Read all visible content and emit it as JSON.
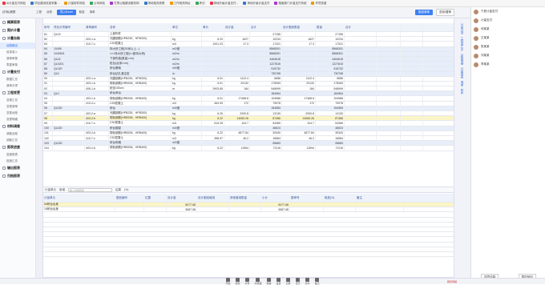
{
  "bookmarks": [
    "Ai计量支付网站",
    "项目建设信息采集...",
    "计量软件网站",
    "公司网站",
    "甘肃公路建设服务网",
    "场地相关政策",
    "工作相关网址",
    "考试",
    "场地升级计量支付...",
    "场地升级计量支付",
    "路面部门计量支付系统",
    "环境查重"
  ],
  "app": {
    "title": "(中标)报表",
    "tabs": [
      "工程",
      "台账",
      "导入Excel",
      "取费",
      "清单",
      "工程量清单表"
    ],
    "import_btn": "导入Excel",
    "active_tab": "取费清单",
    "search_btn": "查找/替换"
  },
  "sidebar": [
    {
      "label": "概算报表",
      "type": "group"
    },
    {
      "label": "报价计量",
      "type": "group"
    },
    {
      "label": "计量台账",
      "type": "group"
    },
    {
      "label": "台账输出",
      "type": "sub",
      "active": true
    },
    {
      "label": "信息录入",
      "type": "sub"
    },
    {
      "label": "清单审核",
      "type": "sub"
    },
    {
      "label": "零星审核",
      "type": "sub"
    },
    {
      "label": "计量支付",
      "type": "group"
    },
    {
      "label": "数据汇总",
      "type": "sub"
    },
    {
      "label": "清单分项",
      "type": "sub"
    },
    {
      "label": "工程变更",
      "type": "group"
    },
    {
      "label": "变更汇总",
      "type": "sub"
    },
    {
      "label": "变更清单",
      "type": "sub"
    },
    {
      "label": "变更台账",
      "type": "sub"
    },
    {
      "label": "变更明细",
      "type": "sub"
    },
    {
      "label": "材料调差",
      "type": "group"
    },
    {
      "label": "调差台账",
      "type": "sub"
    },
    {
      "label": "调差汇总",
      "type": "sub"
    },
    {
      "label": "报表进度",
      "type": "group"
    },
    {
      "label": "进度报表",
      "type": "sub"
    },
    {
      "label": "进度汇总",
      "type": "sub"
    },
    {
      "label": "输出报表",
      "type": "group"
    },
    {
      "label": "归档报表",
      "type": "group"
    }
  ],
  "grid": {
    "headers": [
      "序号",
      "项目分项编号",
      "清单编号",
      "名称",
      "单位",
      "单价",
      "设计量",
      "合计",
      "设计图纸数量",
      "数量",
      "合计",
      "",
      "",
      ""
    ],
    "rows": [
      {
        "n": "81",
        "a": "QL03",
        "b": "",
        "name": "上部构件",
        "unit": "",
        "price": "",
        "q": "",
        "t": "27155",
        "q2": "",
        "t2": "27155",
        "x": "",
        "y": "",
        "z": "",
        "cls": ""
      },
      {
        "n": "82",
        "a": "",
        "b": "403-1-a",
        "name": "光圆钢筋(HPB235、HPB300)",
        "unit": "kg",
        "price": "6.29",
        "q": "1627",
        "t": "10234",
        "q2": "1627",
        "t2": "10234",
        "x": "",
        "y": "",
        "z": "",
        "cls": ""
      },
      {
        "n": "83",
        "a": "",
        "b": "410-7-c",
        "name": "C30混凝土",
        "unit": "m3",
        "price": "1001.23",
        "q": "17.3",
        "t": "17321",
        "q2": "17.3",
        "t2": "17321",
        "x": "",
        "y": "",
        "z": "",
        "cls": ""
      },
      {
        "n": "84",
        "a": "10405",
        "b": "",
        "name": "特大桥工程(30米以上...)",
        "unit": "m2/座",
        "price": "",
        "q": "",
        "t": "8568301",
        "q2": "",
        "t2": "8568301",
        "x": "",
        "y": "",
        "z": "",
        "cls": "blue"
      },
      {
        "n": "85",
        "a": "1040501",
        "b": "",
        "name": "×××特大桥工程(××座特大桥)",
        "unit": "m2/m",
        "price": "",
        "q": "",
        "t": "8568301",
        "q2": "",
        "t2": "8568301",
        "x": "",
        "y": "",
        "z": "",
        "cls": "blue"
      },
      {
        "n": "86",
        "a": "QL02",
        "b": "",
        "name": "下部构造(数量××m)",
        "unit": "m2/m",
        "price": "",
        "q": "",
        "t": "4464618",
        "q2": "",
        "t2": "4464618",
        "x": "",
        "y": "",
        "z": "",
        "cls": "blue"
      },
      {
        "n": "87",
        "a": "QL0201",
        "b": "",
        "name": "桩台(台身××m)",
        "unit": "m2/m",
        "price": "",
        "q": "",
        "t": "1227815",
        "q2": "",
        "t2": "1227815",
        "x": "",
        "y": "",
        "z": "",
        "cls": "blue"
      },
      {
        "n": "88",
        "a": "QL020",
        "b": "",
        "name": "桥台基础",
        "unit": "m3/座",
        "price": "",
        "q": "",
        "t": "915732",
        "q2": "",
        "t2": "915732",
        "x": "",
        "y": "",
        "z": "",
        "cls": "blue"
      },
      {
        "n": "89",
        "a": "QL0",
        "b": "",
        "name": "桥台钻孔灌注桩",
        "unit": "m",
        "price": "",
        "q": "",
        "t": "730768",
        "q2": "",
        "t2": "730768",
        "x": "",
        "y": "",
        "z": "",
        "cls": "blue"
      },
      {
        "n": "90",
        "a": "",
        "b": "403-1-a",
        "name": "光圆钢筋(HPB235、HPB300)",
        "unit": "kg",
        "price": "6.01",
        "q": "1112.4",
        "t": "6686",
        "q2": "1112.4",
        "t2": "6686",
        "x": "",
        "y": "",
        "z": "",
        "cls": ""
      },
      {
        "n": "91",
        "a": "",
        "b": "403-1-b",
        "name": "带肋钢筋(HRB335、HRB400)",
        "unit": "kg",
        "price": "6.01",
        "q": "29132",
        "t": "175083",
        "q2": "29132",
        "t2": "175083",
        "x": "",
        "y": "",
        "z": "",
        "cls": ""
      },
      {
        "n": "92",
        "a": "",
        "b": "405-1-b",
        "name": "桩径150cm",
        "unit": "m",
        "price": "2903.65",
        "q": "184",
        "t": "548999",
        "q2": "184",
        "t2": "548999",
        "x": "",
        "y": "",
        "z": "",
        "cls": ""
      },
      {
        "n": "93",
        "a": "QLC",
        "b": "",
        "name": "桥台承台",
        "unit": "",
        "price": "",
        "q": "",
        "t": "184964",
        "q2": "",
        "t2": "184964",
        "x": "",
        "y": "",
        "z": "",
        "cls": "blue"
      },
      {
        "n": "94",
        "a": "",
        "b": "403-1-b",
        "name": "带肋钢筋(HRB335、HRB400)",
        "unit": "kg",
        "price": "6.01",
        "q": "17468.6",
        "t": "104986",
        "q2": "17468.6",
        "t2": "104986",
        "x": "",
        "y": "",
        "z": "",
        "cls": ""
      },
      {
        "n": "95",
        "a": "",
        "b": "410-2-c",
        "name": "C25混凝土",
        "unit": "m3",
        "price": "464.99",
        "q": "172",
        "t": "79978",
        "q2": "172",
        "t2": "79978",
        "x": "",
        "y": "",
        "z": "",
        "cls": ""
      },
      {
        "n": "96",
        "a": "QL020",
        "b": "",
        "name": "桥台",
        "unit": "m3/座",
        "price": "",
        "q": "",
        "t": "154983",
        "q2": "",
        "t2": "154983",
        "x": "",
        "y": "",
        "z": "",
        "cls": "blue"
      },
      {
        "n": "97",
        "a": "",
        "b": "403-2-a",
        "name": "光圆钢筋(HPB235、HPB300)",
        "unit": "kg",
        "price": "6.26",
        "q": "2090.8",
        "t": "13130",
        "q2": "2090.8",
        "t2": "13130",
        "x": "",
        "y": "",
        "z": "",
        "cls": ""
      },
      {
        "n": "98",
        "a": "",
        "b": "403-2-b",
        "name": "带肋钢筋(HRB335、HRB400)",
        "unit": "kg",
        "price": "6.22",
        "q": "14065.26",
        "t": "87486",
        "q2": "14065.26",
        "t2": "87486",
        "x": "",
        "y": "",
        "z": "",
        "cls": "sel"
      },
      {
        "n": "99",
        "a": "",
        "b": "410-7-c",
        "name": "C30混凝土",
        "unit": "m3",
        "price": "519.25",
        "q": "104.7",
        "t": "54365",
        "q2": "104.7",
        "t2": "54365",
        "x": "",
        "y": "",
        "z": "",
        "cls": ""
      },
      {
        "n": "100",
        "a": "QL020",
        "b": "",
        "name": "桥台帽梁",
        "unit": "m3/座",
        "price": "",
        "q": "",
        "t": "46524",
        "q2": "",
        "t2": "46524",
        "x": "",
        "y": "",
        "z": "",
        "cls": "blue"
      },
      {
        "n": "101",
        "a": "",
        "b": "403-2-b",
        "name": "带肋钢筋(HRB335、HRB400)",
        "unit": "kg",
        "price": "6.22",
        "q": "4877.84",
        "t": "30340",
        "q2": "4877.84",
        "t2": "30340",
        "x": "",
        "y": "",
        "z": "",
        "cls": ""
      },
      {
        "n": "102",
        "a": "",
        "b": "410-7-c",
        "name": "C30混凝土",
        "unit": "m3",
        "price": "358.97",
        "q": "46.2",
        "t": "16584",
        "q2": "46.2",
        "t2": "16584",
        "x": "",
        "y": "",
        "z": "",
        "cls": ""
      },
      {
        "n": "103",
        "a": "QL020",
        "b": "",
        "name": "桥台侧墙",
        "unit": "m3/座",
        "price": "",
        "q": "",
        "t": "95683",
        "q2": "",
        "t2": "95683",
        "x": "",
        "y": "",
        "z": "",
        "cls": "blue"
      },
      {
        "n": "104",
        "a": "",
        "b": "403-2-b",
        "name": "带肋钢筋(HRB335、HRB400)",
        "unit": "kg",
        "price": "6.22",
        "q": "11594",
        "t": "72115",
        "q2": "11594",
        "t2": "72115",
        "x": "",
        "y": "",
        "z": "",
        "cls": ""
      }
    ]
  },
  "toolbar2": {
    "label": "计量单元",
    "add": "新增",
    "input_placeholder": "输入内容查找",
    "result": "结果",
    "pct": "(%)"
  },
  "grid2": {
    "headers": [
      "计量单元",
      "图纸编号",
      "位置",
      "设计量",
      "设计图纸增减",
      "其他增减数量",
      "小计",
      "图审号",
      "取费(%)",
      "备注"
    ],
    "rows": [
      {
        "n": "1",
        "name": "0#桥台台身",
        "q": "8477.68",
        "sum": "8477.68"
      },
      {
        "n": "2",
        "name": "1#桥台台身",
        "q": "5587.58",
        "sum": "5587.58"
      }
    ]
  },
  "rail": [
    "计量分项",
    "工程量汇总",
    "台账明细",
    "计量报表",
    "清单",
    "附件"
  ],
  "chat": [
    {
      "name": "宁夏计量支付"
    },
    {
      "name": "计量支付"
    },
    {
      "name": "何某某"
    },
    {
      "name": "王某某"
    },
    {
      "name": "张某某"
    },
    {
      "name": "刘某某"
    },
    {
      "name": "李某某"
    }
  ],
  "chat_bottom": [
    "同意结算",
    "暂时驳回"
  ],
  "taskbar": [
    "开始",
    "搜索",
    "文件",
    "浏览器",
    "微信",
    "设置",
    "记录",
    "日历",
    "共享",
    "备忘"
  ],
  "taskbar_right": "网页申报"
}
